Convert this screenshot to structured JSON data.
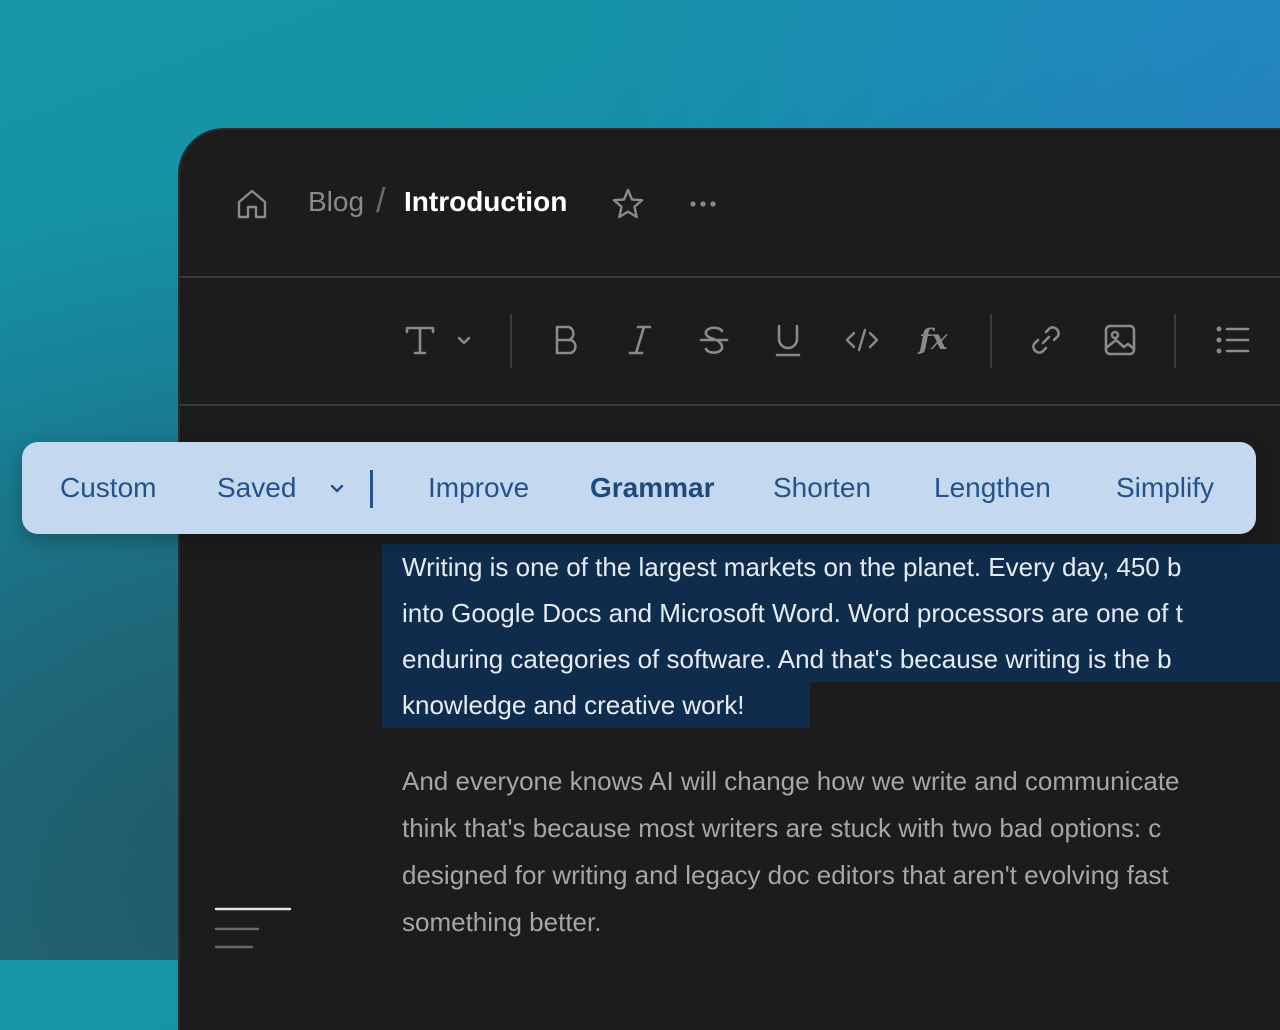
{
  "breadcrumb": {
    "parent": "Blog",
    "separator": "/",
    "current": "Introduction"
  },
  "toolbar": {
    "text_style_icon": "text-style-icon",
    "buttons": [
      "bold-icon",
      "italic-icon",
      "strikethrough-icon",
      "underline-icon",
      "code-icon",
      "formula-icon",
      "link-icon",
      "image-icon",
      "bullet-list-icon"
    ]
  },
  "ai_menu": {
    "custom": "Custom",
    "saved": "Saved",
    "improve": "Improve",
    "grammar": "Grammar",
    "shorten": "Shorten",
    "lengthen": "Lengthen",
    "simplify": "Simplify",
    "active": "Grammar"
  },
  "document": {
    "selected_lines": [
      "Writing is one of the largest markets on the planet. Every day, 450 b",
      "into Google Docs and Microsoft Word. Word processors are one of t",
      "enduring categories of software. And that's because writing is the b",
      "knowledge and creative work!"
    ],
    "paragraph_lines": [
      "And everyone knows AI will change how we write and communicate",
      "think that's because most writers are stuck with two bad options: c",
      "designed for writing and legacy doc editors that aren't evolving fast",
      "something better."
    ]
  },
  "colors": {
    "window_bg": "#1c1c1d",
    "selection_bg": "#0f2c4c",
    "ai_bar_bg": "#c4d9ef",
    "ai_text": "#24528a"
  }
}
